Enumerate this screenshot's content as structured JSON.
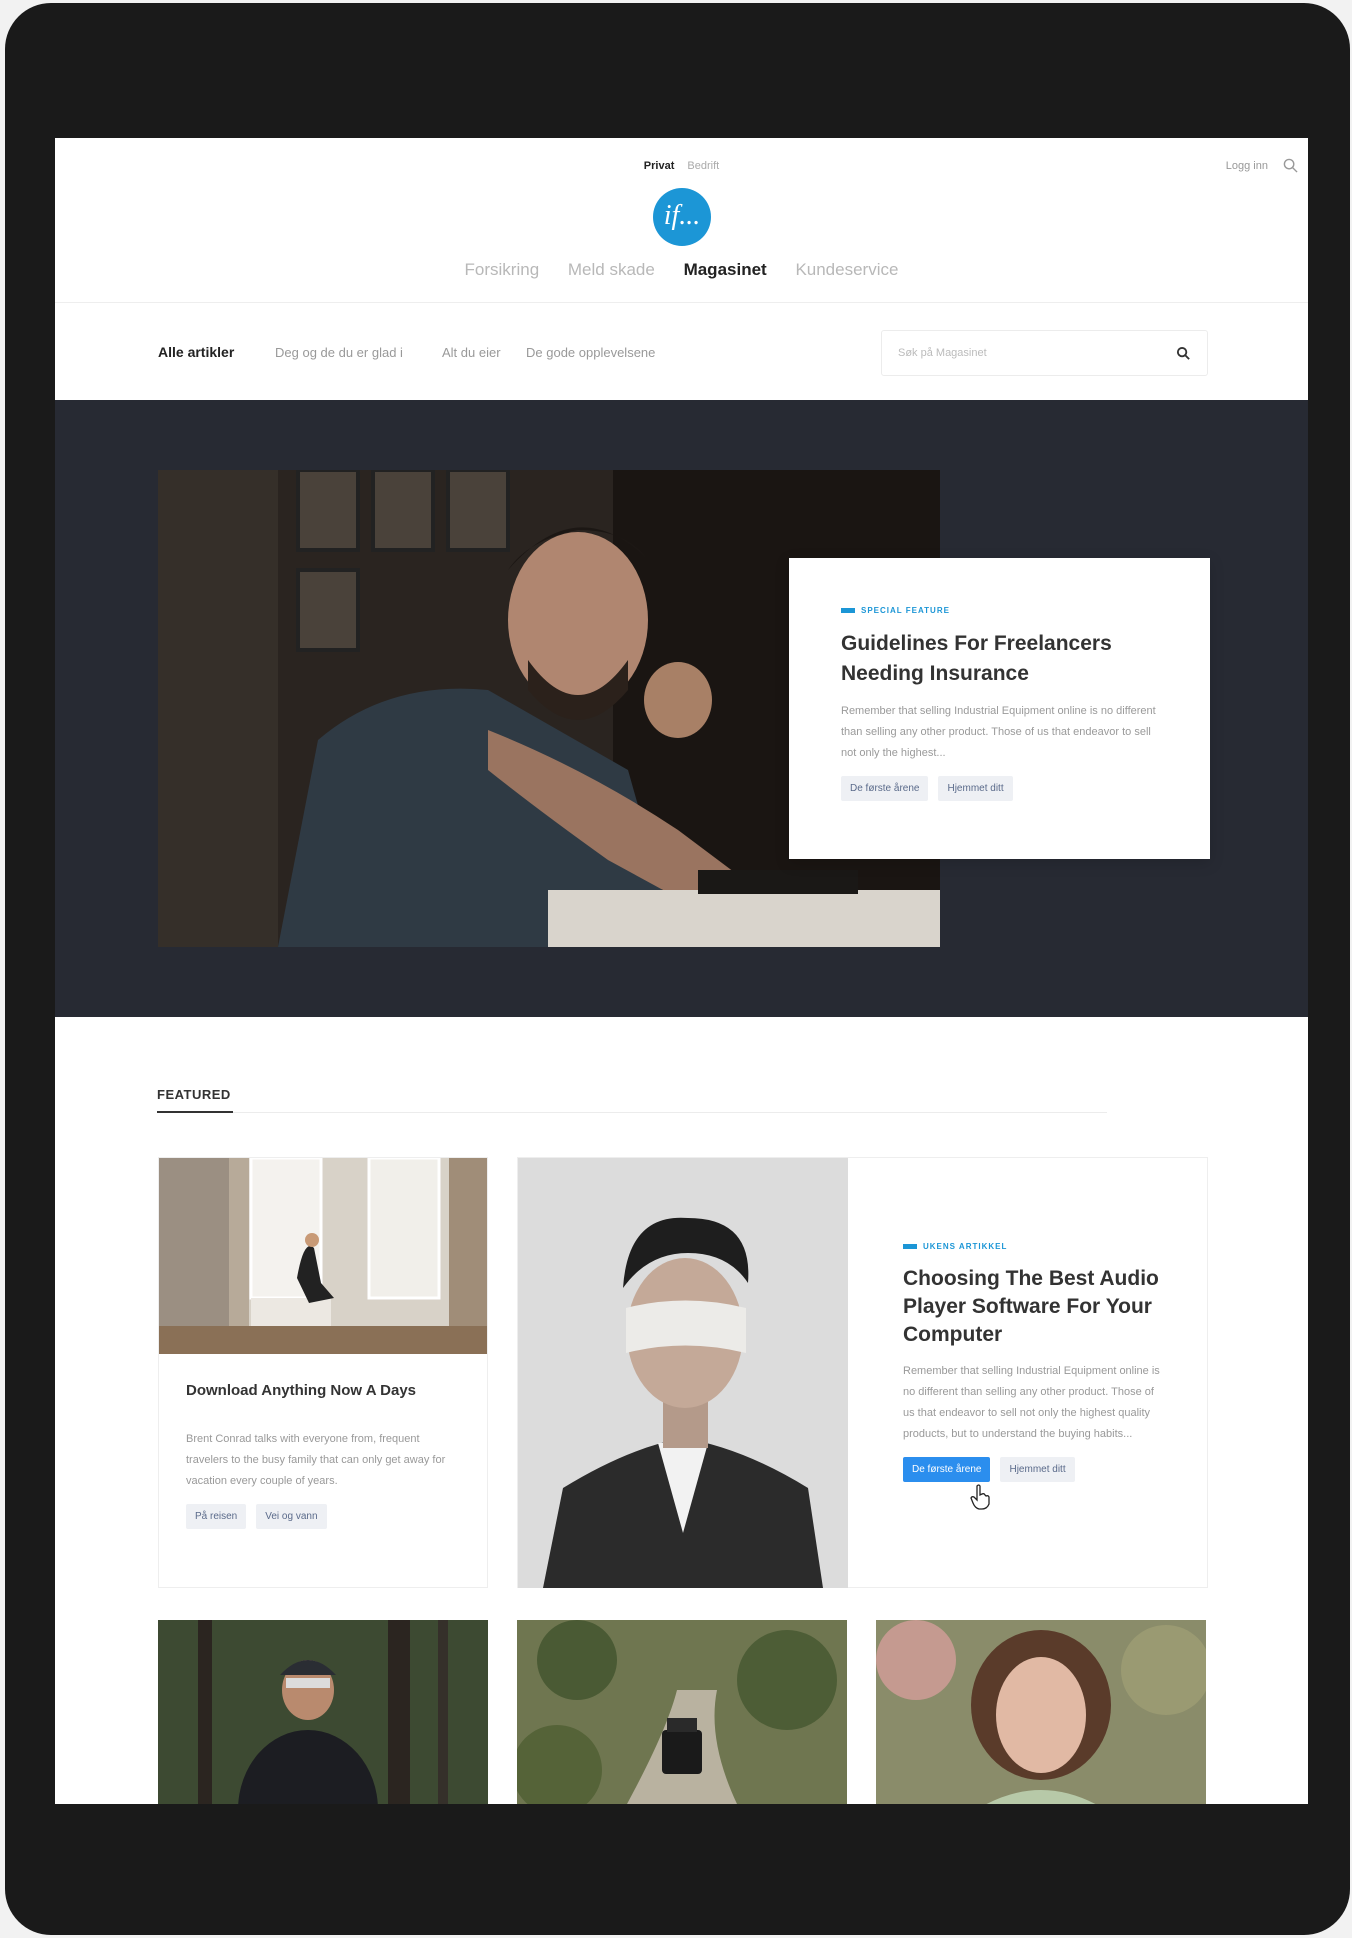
{
  "header": {
    "segments": [
      "Privat",
      "Bedrift"
    ],
    "login": "Logg inn",
    "logo_text": "if...",
    "nav": [
      "Forsikring",
      "Meld skade",
      "Magasinet",
      "Kundeservice"
    ]
  },
  "subnav": {
    "all": "Alle artikler",
    "categories": [
      "Deg og de du er glad i",
      "Alt du eier",
      "De gode opplevelsene"
    ],
    "search_placeholder": "Søk på Magasinet"
  },
  "hero": {
    "kicker": "Special feature",
    "title": "Guidelines For Freelancers Needing Insurance",
    "excerpt": "Remember that selling Industrial Equipment online is no different than selling any other product. Those of us that endeavor to sell not only the highest...",
    "tags": [
      "De første årene",
      "Hjemmet ditt"
    ]
  },
  "featured": {
    "label": "FEATURED",
    "small_card": {
      "title": "Download Anything Now A Days",
      "excerpt": "Brent Conrad talks with everyone from, frequent travelers to the busy family that can only get away for vacation every couple of years.",
      "tags": [
        "På reisen",
        "Vei og vann"
      ]
    },
    "large_card": {
      "kicker": "Ukens artikkel",
      "title": "Choosing The Best Audio Player Software For Your Computer",
      "excerpt": "Remember that selling Industrial Equipment online is no different than selling any other product. Those of us that endeavor to sell not only the highest quality products, but to understand the buying habits...",
      "tags": [
        "De første årene",
        "Hjemmet ditt"
      ]
    }
  },
  "colors": {
    "brand": "#1c96d6",
    "hero_bg": "#272a33",
    "button_blue": "#2b8eee"
  }
}
